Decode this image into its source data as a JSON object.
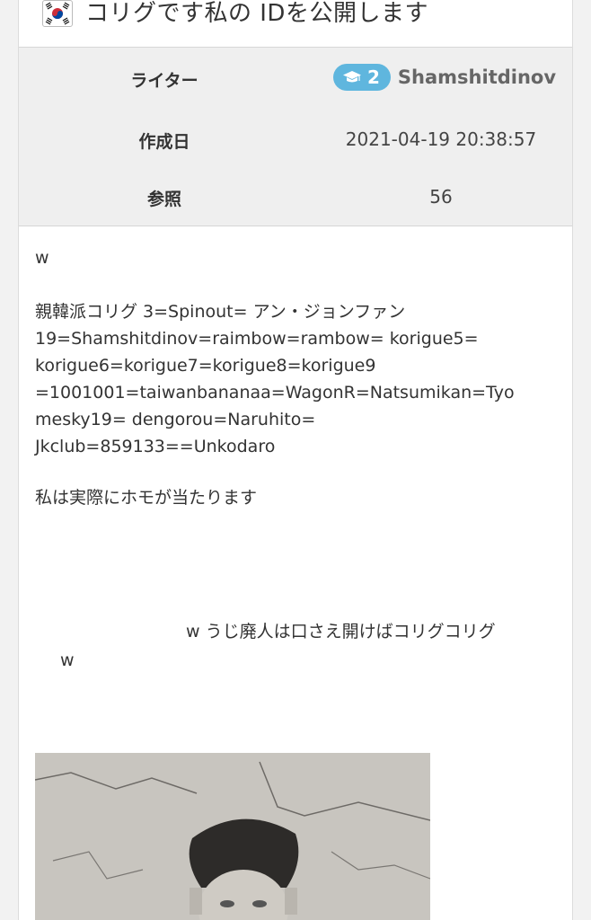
{
  "post": {
    "title": "コリグです私の IDを公開します",
    "flag_icon": "south-korea-flag-icon"
  },
  "meta": {
    "writer_label": "ライター",
    "writer_level": "2",
    "writer_level_icon": "graduation-cap-icon",
    "writer_name": "Shamshitdinov",
    "date_label": "作成日",
    "date_value": "2021-04-19 20:38:57",
    "views_label": "参照",
    "views_value": "56"
  },
  "content": {
    "line1": "w",
    "para2_line1": "親韓派コリグ 3=Spinout= アン・ジョンファン",
    "para2_line2": "19=Shamshitdinov=raimbow=rambow= korigue5=",
    "para2_line3": "korigue6=korigue7=korigue8=korigue9",
    "para2_line4": "=1001001=taiwanbananaa=WagonR=Natsumikan=Tyo",
    "para2_line5": "mesky19= dengorou=Naruhito=",
    "para2_line6": "Jkclub=859133==Unkodaro",
    "para3": "私は実際にホモが当たります",
    "para4_line1": "w うじ廃人は口さえ開けばコリグコリグ",
    "para4_line2": "w"
  },
  "colors": {
    "badge": "#5fb6de",
    "meta_bg": "#efefef",
    "flag_red": "#cd2e3a",
    "flag_blue": "#0047a0"
  }
}
